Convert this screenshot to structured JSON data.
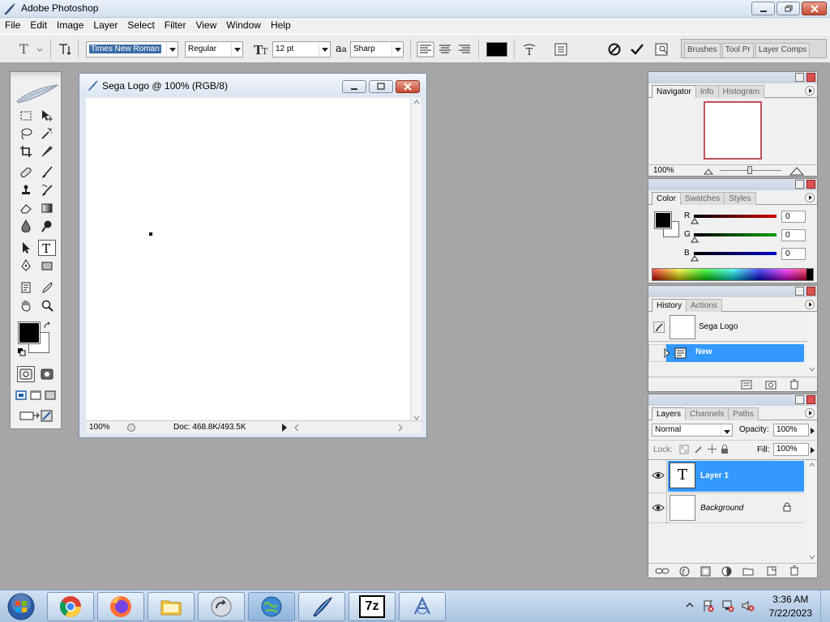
{
  "window": {
    "title": "Adobe Photoshop"
  },
  "menu": [
    "File",
    "Edit",
    "Image",
    "Layer",
    "Select",
    "Filter",
    "View",
    "Window",
    "Help"
  ],
  "options": {
    "font_family": "Times New Roman",
    "font_style": "Regular",
    "font_size": "12 pt",
    "antialias_icon_text": "a",
    "antialias_label": "a",
    "antialias": "Sharp",
    "text_color": "#000000",
    "well_tabs": [
      "Brushes",
      "Tool Pr",
      "Layer Comps"
    ]
  },
  "document": {
    "title": "Sega Logo @ 100% (RGB/8)",
    "zoom": "100%",
    "doc_size": "Doc: 468.8K/493.5K"
  },
  "toolbox": {
    "foreground": "#000000",
    "background": "#ffffff",
    "tools": [
      "marquee",
      "move",
      "lasso",
      "magic-wand",
      "crop",
      "slice",
      "healing",
      "brush",
      "stamp",
      "history-brush",
      "eraser",
      "gradient",
      "blur",
      "dodge",
      "path-select",
      "type",
      "pen",
      "shape",
      "notes",
      "eyedropper",
      "hand",
      "zoom"
    ]
  },
  "navigator": {
    "tabs": [
      "Navigator",
      "Info",
      "Histogram"
    ],
    "zoom": "100%"
  },
  "color": {
    "tabs": [
      "Color",
      "Swatches",
      "Styles"
    ],
    "channels": [
      {
        "label": "R",
        "value": "0",
        "color": "#d40000"
      },
      {
        "label": "G",
        "value": "0",
        "color": "#00a000"
      },
      {
        "label": "B",
        "value": "0",
        "color": "#0000c8"
      }
    ]
  },
  "history": {
    "tabs": [
      "History",
      "Actions"
    ],
    "snapshot": "Sega Logo",
    "states": [
      "New"
    ]
  },
  "layers": {
    "tabs": [
      "Layers",
      "Channels",
      "Paths"
    ],
    "blend_mode": "Normal",
    "opacity_label": "Opacity:",
    "opacity": "100%",
    "lock_label": "Lock:",
    "fill_label": "Fill:",
    "fill": "100%",
    "items": [
      {
        "name": "Layer 1",
        "thumb": "T",
        "selected": true
      },
      {
        "name": "Background",
        "thumb": "",
        "selected": false
      }
    ]
  },
  "taskbar": {
    "time": "3:36 AM",
    "date": "7/22/2023",
    "apps": [
      "chrome",
      "firefox",
      "explorer",
      "arrow-app",
      "globe-app",
      "feather-app",
      "7zip",
      "adobe-app"
    ],
    "sevenzip_label": "7z"
  },
  "colors": {
    "selection": "#3399ff",
    "accent": "#3a7bd5"
  }
}
